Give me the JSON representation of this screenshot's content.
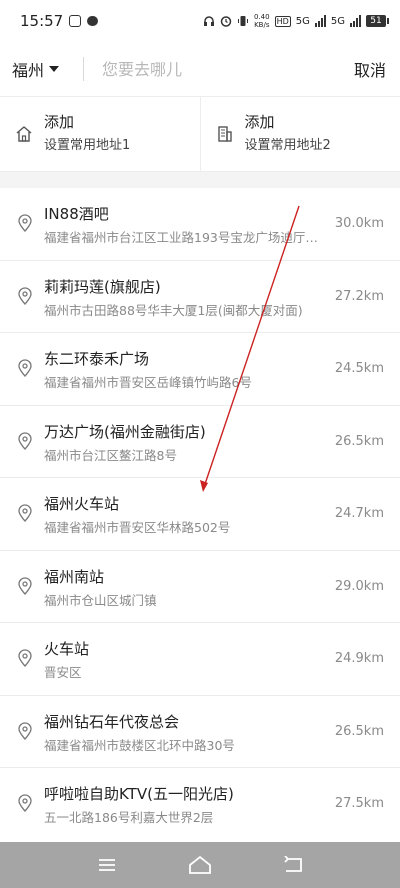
{
  "status_bar": {
    "time": "15:57",
    "net_speed_value": "0.40",
    "net_speed_unit": "KB/s",
    "sim1": "5G",
    "sim2": "5G",
    "hd": "HD",
    "battery": "51"
  },
  "search": {
    "city": "福州",
    "placeholder": "您要去哪儿",
    "value": "",
    "cancel_label": "取消"
  },
  "shortcuts": [
    {
      "title": "添加",
      "subtitle": "设置常用地址1",
      "icon": "home-icon"
    },
    {
      "title": "添加",
      "subtitle": "设置常用地址2",
      "icon": "building-icon"
    }
  ],
  "results": [
    {
      "name": "IN88酒吧",
      "address": "福建省福州市台江区工业路193号宝龙广场迪厅…",
      "distance": "30.0km"
    },
    {
      "name": "莉莉玛莲(旗舰店)",
      "address": "福州市古田路88号华丰大厦1层(闽都大厦对面)",
      "distance": "27.2km"
    },
    {
      "name": "东二环泰禾广场",
      "address": "福建省福州市晋安区岳峰镇竹屿路6号",
      "distance": "24.5km"
    },
    {
      "name": "万达广场(福州金融街店)",
      "address": "福州市台江区鳌江路8号",
      "distance": "26.5km"
    },
    {
      "name": "福州火车站",
      "address": "福建省福州市晋安区华林路502号",
      "distance": "24.7km"
    },
    {
      "name": "福州南站",
      "address": "福州市仓山区城门镇",
      "distance": "29.0km"
    },
    {
      "name": "火车站",
      "address": "晋安区",
      "distance": "24.9km"
    },
    {
      "name": "福州钻石年代夜总会",
      "address": "福建省福州市鼓楼区北环中路30号",
      "distance": "26.5km"
    },
    {
      "name": "呼啦啦自助KTV(五一阳光店)",
      "address": "五一北路186号利嘉大世界2层",
      "distance": "27.5km"
    }
  ],
  "nav": {
    "menu_icon": "menu-icon",
    "home_icon": "home-nav-icon",
    "back_icon": "back-icon"
  },
  "colors": {
    "annotation_arrow": "#cc2222",
    "nav_bar": "#a5a5a5"
  }
}
